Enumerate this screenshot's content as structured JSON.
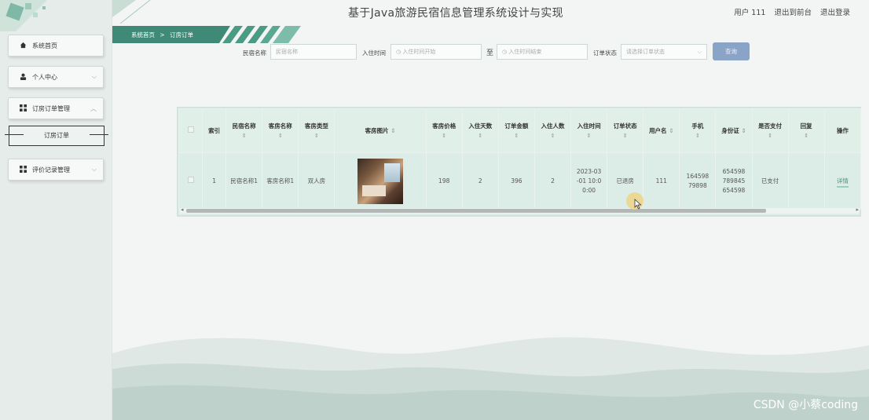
{
  "app": {
    "title": "基于Java旅游民宿信息管理系统设计与实现",
    "user_label": "用户 111",
    "goto_front": "退出到前台",
    "logout": "退出登录"
  },
  "breadcrumb": {
    "home": "系统首页",
    "sep": ">",
    "current": "订房订单"
  },
  "sidebar": {
    "items": [
      {
        "label": "系统首页",
        "icon": "home-icon"
      },
      {
        "label": "个人中心",
        "icon": "user-icon"
      },
      {
        "label": "订房订单管理",
        "icon": "grid-icon"
      },
      {
        "label": "评价记录管理",
        "icon": "grid-icon"
      }
    ],
    "submenu": {
      "label": "订房订单"
    }
  },
  "search": {
    "homestay_label": "民宿名称",
    "homestay_placeholder": "民宿名称",
    "checkin_label": "入住时间",
    "start_placeholder": "入住时间开始",
    "to": "至",
    "end_placeholder": "入住时间结束",
    "status_label": "订单状态",
    "status_placeholder": "请选择订单状态",
    "query_button": "查询"
  },
  "table": {
    "headers": [
      "",
      "索引",
      "民宿名称",
      "客房名称",
      "客房类型",
      "客房图片",
      "客房价格",
      "入住天数",
      "订单金额",
      "入住人数",
      "入住时间",
      "订单状态",
      "用户名",
      "手机",
      "身份证",
      "是否支付",
      "回复",
      "操作"
    ],
    "rows": [
      {
        "index": "1",
        "homestay": "民宿名称1",
        "room": "客房名称1",
        "type": "双人房",
        "price": "198",
        "days": "2",
        "amount": "396",
        "guests": "2",
        "checkin": "2023-03-01 10:00:00",
        "status": "已退房",
        "username": "111",
        "phone": "16459879898",
        "idcard": "654598789845654598",
        "paid": "已支付",
        "reply": "",
        "action": "详情"
      }
    ]
  },
  "watermark": "CSDN @小蔡coding",
  "colors": {
    "accent": "#4a8f80",
    "query_button": "#8aa4c7",
    "sidebar_bg": "#e6ecea"
  }
}
